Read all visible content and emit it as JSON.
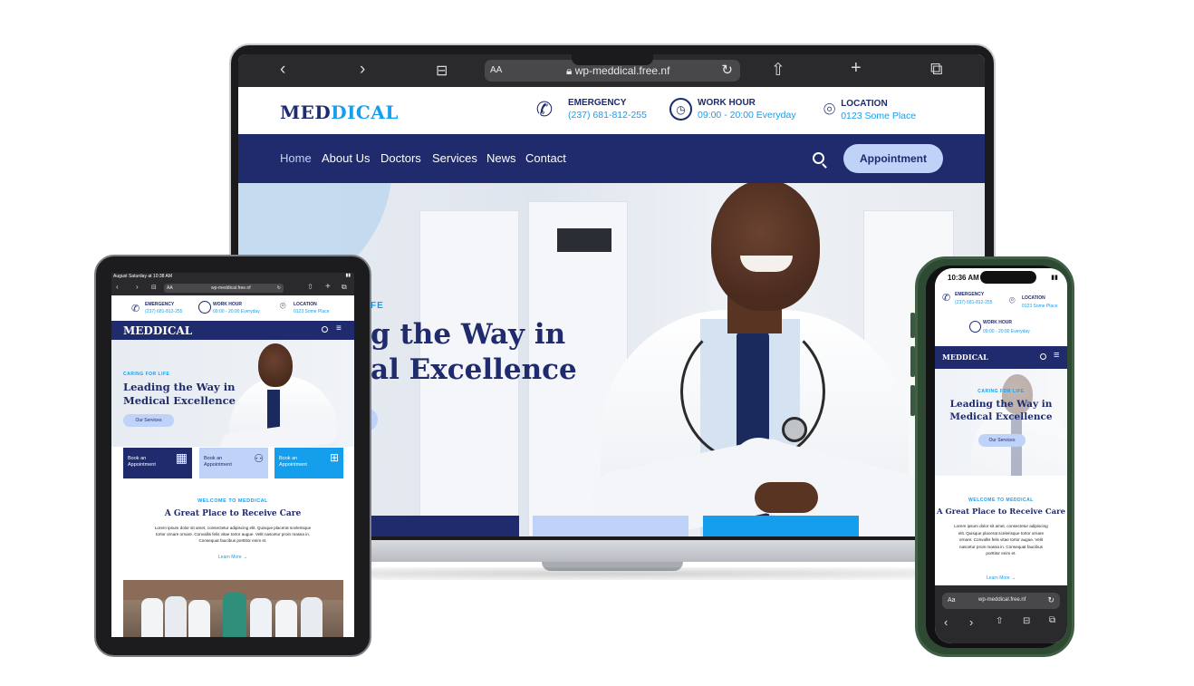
{
  "browser": {
    "url": "wp-meddical.free.nf",
    "aa_label": "AA",
    "phone_aa_label": "Aa",
    "back": "‹",
    "forward": "›",
    "reload": "↻",
    "share": "⇧",
    "new_tab": "+",
    "tabs": "⧉",
    "bookmarks": "⊟"
  },
  "brand": {
    "part1": "MED",
    "part2": "DICAL",
    "full": "MEDDICAL"
  },
  "topinfo": {
    "emergency_label": "EMERGENCY",
    "emergency_value": "(237) 681-812-255",
    "workhour_label": "WORK HOUR",
    "workhour_value": "09:00 - 20:00 Everyday",
    "location_label": "LOCATION",
    "location_value": "0123 Some Place"
  },
  "nav": {
    "items": [
      "Home",
      "About Us",
      "Doctors",
      "Services",
      "News",
      "Contact"
    ],
    "appointment": "Appointment"
  },
  "hero": {
    "kicker": "CARING FOR LIFE",
    "kicker_visible": "FE",
    "title_line1": "Leading the Way in",
    "title_line2": "Medical Excellence",
    "laptop_line1": "g the Way in",
    "laptop_line2": "al Excellence",
    "button": "Our Services"
  },
  "cards": [
    {
      "label_line1": "Book an",
      "label_line2": "Appointment",
      "color": "#1f2b6c",
      "text_color": "#ffffff"
    },
    {
      "label_line1": "Book an",
      "label_line2": "Appointment",
      "color": "#bfd2f8",
      "text_color": "#1f2b6c"
    },
    {
      "label_line1": "Book an",
      "label_line2": "Appointment",
      "color": "#159eec",
      "text_color": "#ffffff"
    }
  ],
  "welcome": {
    "kicker": "WELCOME TO MEDDICAL",
    "title": "A Great Place to Receive Care",
    "body_line1": "Lorem ipsum dolor sit amet, consectetur adipiscing elit. Quisque placerat scelerisque",
    "body_line2": "tortor ornare ornare. Convallis felis vitae tortor augue. Velit nascetur proin massa in.",
    "body_line3": "Consequat faucibus porttitor enim et.",
    "phone_body": [
      "Lorem ipsum dolor sit amet, consectetur adipiscing",
      "elit. Quisque placerat scelerisque tortor ornare",
      "ornare. Convallis felis vitae tortor augue. Velit",
      "nascetur proin massa in. Consequat faucibus",
      "porttitor enim et."
    ],
    "learn_more": "Learn More"
  },
  "tablet_status": {
    "time": "August Saturday at 10:38 AM"
  },
  "phone_status": {
    "time": "10:36 AM"
  },
  "colors": {
    "navy": "#1f2b6c",
    "accent": "#159eec",
    "light": "#bfd2f8"
  }
}
